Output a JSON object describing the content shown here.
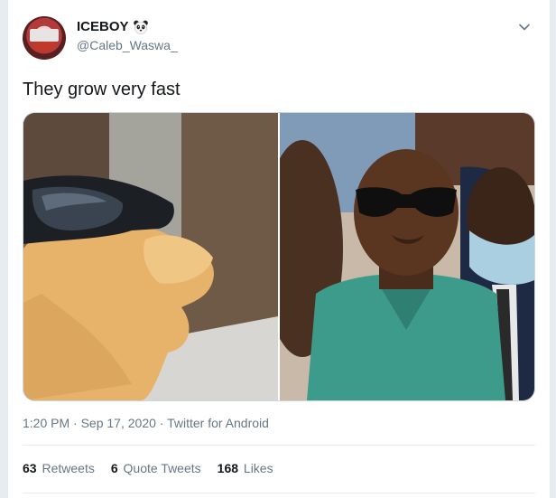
{
  "tweet": {
    "author": {
      "display_name": "ICEBOY",
      "handle": "@Caleb_Waswa_",
      "name_emoji_icon": "panda-icon"
    },
    "text": "They grow very fast",
    "media": [
      {
        "icon": "chicken-with-sunglasses-photo"
      },
      {
        "icon": "man-with-sunglasses-photo"
      }
    ],
    "meta": {
      "time": "1:20 PM",
      "sep1": " · ",
      "date": "Sep 17, 2020",
      "sep2": " · ",
      "source": "Twitter for Android"
    },
    "stats": {
      "retweets_count": "63",
      "retweets_label": "Retweets",
      "quotes_count": "6",
      "quotes_label": "Quote Tweets",
      "likes_count": "168",
      "likes_label": "Likes"
    },
    "colors": {
      "text_primary": "#14171a",
      "text_secondary": "#657786",
      "border": "#e6ecf0"
    }
  }
}
